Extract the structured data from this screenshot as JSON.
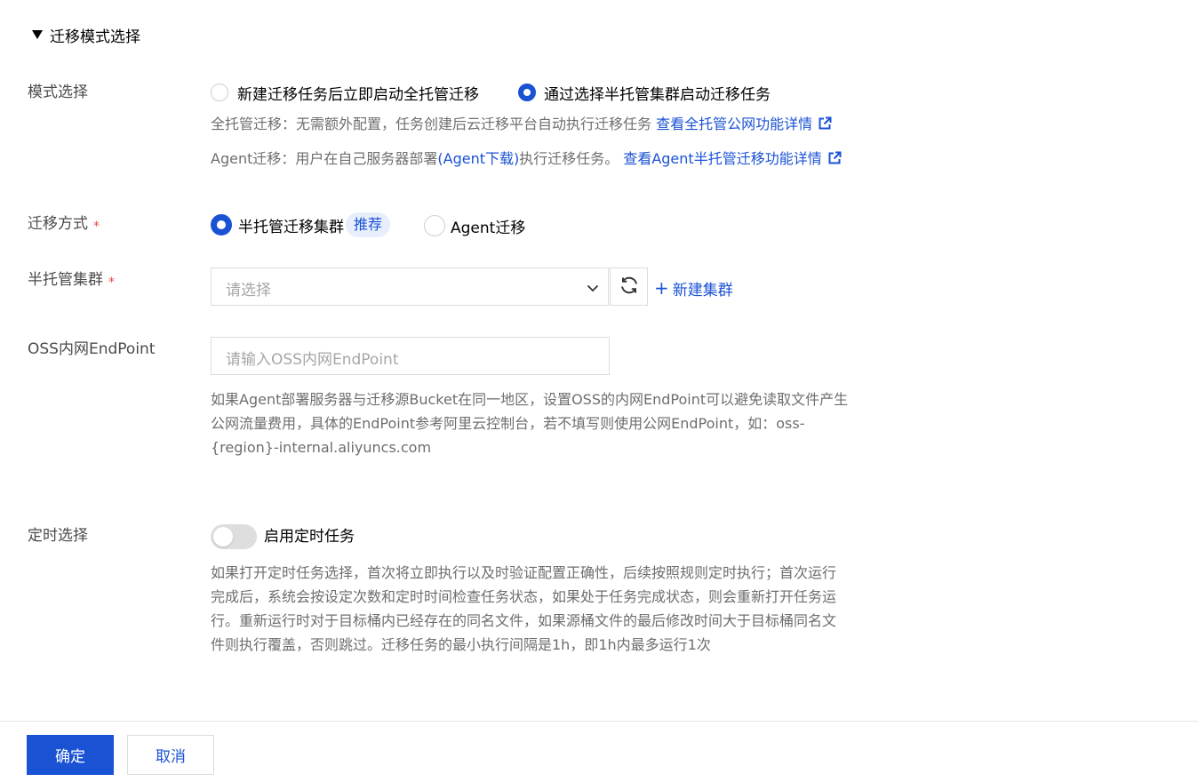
{
  "section": {
    "title": "迁移模式选择"
  },
  "mode": {
    "label": "模式选择",
    "options": [
      {
        "label": "新建迁移任务后立即启动全托管迁移",
        "checked": false
      },
      {
        "label": "通过选择半托管集群启动迁移任务",
        "checked": true
      }
    ],
    "tip_full_prefix": "全托管迁移：无需额外配置，任务创建后云迁移平台自动执行迁移任务 ",
    "tip_full_link": "查看全托管公网功能详情",
    "tip_agent_prefix": "Agent迁移：用户在自己服务器部署",
    "tip_agent_download": "(Agent下载)",
    "tip_agent_middle": "执行迁移任务。 ",
    "tip_agent_link": "查看Agent半托管迁移功能详情"
  },
  "method": {
    "label": "迁移方式",
    "required_mark": "*",
    "options": [
      {
        "label": "半托管迁移集群",
        "checked": true
      },
      {
        "label": "Agent迁移",
        "checked": false
      }
    ],
    "badge": "推荐"
  },
  "cluster": {
    "label": "半托管集群",
    "required_mark": "*",
    "placeholder": "请选择",
    "new_cluster": "新建集群",
    "plus": "+"
  },
  "endpoint": {
    "label": "OSS内网EndPoint",
    "placeholder": "请输入OSS内网EndPoint",
    "help_lines": [
      "如果Agent部署服务器与迁移源Bucket在同一地区，设置OSS的内网EndPoint可以避免读取文件产生",
      "公网流量费用，具体的EndPoint参考阿里云控制台，若不填写则使用公网EndPoint，如：oss-",
      "{region}-internal.aliyuncs.com"
    ]
  },
  "schedule": {
    "label": "定时选择",
    "toggle_label": "启用定时任务",
    "enabled": false,
    "help_lines": [
      "如果打开定时任务选择，首次将立即执行以及时验证配置正确性，后续按照规则定时执行；首次运行",
      "完成后，系统会按设定次数和定时时间检查任务状态，如果处于任务完成状态，则会重新打开任务运",
      "行。重新运行时对于目标桶内已经存在的同名文件，如果源桶文件的最后修改时间大于目标桶同名文",
      "件则执行覆盖，否则跳过。迁移任务的最小执行间隔是1h，即1h内最多运行1次"
    ]
  },
  "footer": {
    "confirm": "确定",
    "cancel": "取消"
  },
  "colors": {
    "primary": "#1a52d4",
    "required": "#e54545",
    "help_text": "#6e6e6e",
    "label_text": "#4b4b4b"
  },
  "icons": {
    "collapse": "caret-down-icon",
    "external_link": "external-link-icon",
    "select": "chevron-down-icon",
    "refresh": "refresh-icon"
  }
}
